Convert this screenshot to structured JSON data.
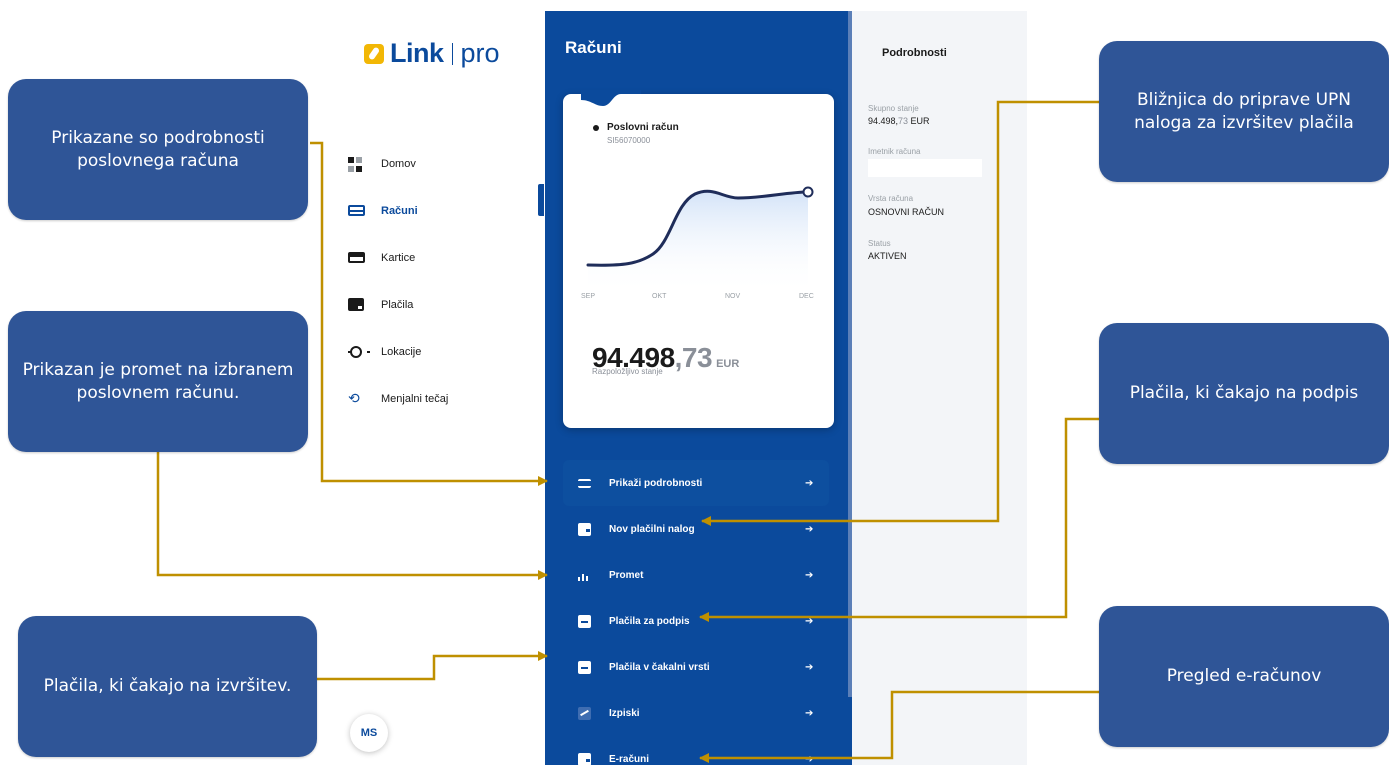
{
  "logo": {
    "name": "Link",
    "suffix": "pro"
  },
  "nav": {
    "items": [
      {
        "label": "Domov",
        "icon": "grid-icon"
      },
      {
        "label": "Računi",
        "icon": "card-icon"
      },
      {
        "label": "Kartice",
        "icon": "credit-card-icon"
      },
      {
        "label": "Plačila",
        "icon": "wallet-icon"
      },
      {
        "label": "Lokacije",
        "icon": "location-icon"
      },
      {
        "label": "Menjalni tečaj",
        "icon": "exchange-icon"
      }
    ],
    "active_index": 1
  },
  "avatar": {
    "initials": "MS"
  },
  "accounts_panel": {
    "title": "Računi",
    "card": {
      "account_name": "Poslovni račun",
      "iban": "SI56070000",
      "balance_whole": "94.498",
      "balance_cents": ",73",
      "currency": "EUR",
      "balance_label": "Razpoložljivo stanje",
      "chart_months": [
        "SEP",
        "OKT",
        "NOV",
        "DEC"
      ]
    },
    "menu": [
      {
        "label": "Prikaži podrobnosti",
        "icon": "details-icon"
      },
      {
        "label": "Nov plačilni nalog",
        "icon": "wallet-icon"
      },
      {
        "label": "Promet",
        "icon": "bar-chart-icon"
      },
      {
        "label": "Plačila za podpis",
        "icon": "document-icon"
      },
      {
        "label": "Plačila v čakalni vrsti",
        "icon": "document-icon"
      },
      {
        "label": "Izpiski",
        "icon": "statement-icon"
      },
      {
        "label": "E-računi",
        "icon": "wallet-icon"
      }
    ],
    "arrow": "➔"
  },
  "details": {
    "title": "Podrobnosti",
    "total_label": "Skupno stanje",
    "total_whole": "94.498,",
    "total_cents": "73",
    "total_currency": " EUR",
    "holder_label": "Imetnik računa",
    "type_label": "Vrsta računa",
    "type_value": "OSNOVNI RAČUN",
    "status_label": "Status",
    "status_value": "AKTIVEN"
  },
  "callouts": {
    "details": "Prikazane so podrobnosti poslovnega računa",
    "turnover": "Prikazan je promet na izbranem poslovnem računu.",
    "queue": "Plačila, ki čakajo na izvršitev.",
    "upn": "Bližnjica do priprave UPN naloga za izvršitev plačila",
    "sign": "Plačila, ki čakajo na podpis",
    "einvoice": "Pregled e-računov"
  },
  "colors": {
    "brand_blue": "#0b4a9c",
    "callout_blue": "#2f5597",
    "connector_gold": "#bf9000"
  }
}
